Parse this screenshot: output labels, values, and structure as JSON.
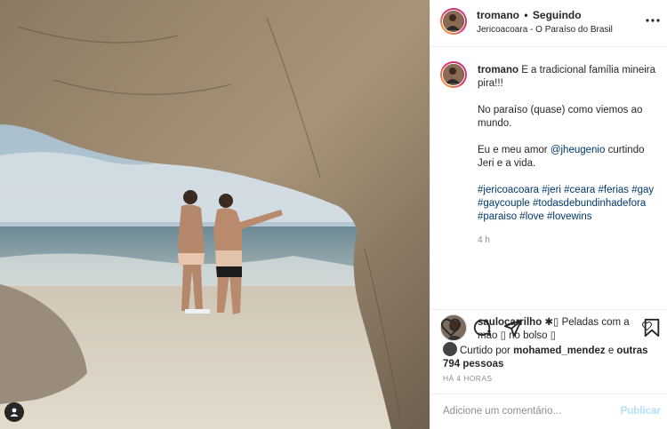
{
  "post": {
    "author": "tromano",
    "separator": "•",
    "follow_status": "Seguindo",
    "location": "Jericoacoara -  O Paraíso do Brasil",
    "more_icon": "more-horizontal-icon",
    "tag_icon": "user-tag-icon"
  },
  "caption": {
    "username": "tromano",
    "line1": " E a tradicional família mineira pira!!!",
    "line2": "No paraíso (quase) como viemos ao mundo.",
    "line3_before": "Eu e meu amor ",
    "mention": "@jheugenio",
    "line3_after": " curtindo Jeri e a vida.",
    "hashtags": "#jericoacoara #jeri #ceara #ferias #gay #gaycouple #todasdebundinhadefora #paraiso #love #lovewins",
    "time": "4 h"
  },
  "comment": {
    "username": "saulocarrilho",
    "text": " ✱▯ Peladas com a mão ▯ no bolso ▯",
    "like_icon": "heart-outline-icon"
  },
  "actions": {
    "like_icon": "heart-icon",
    "comment_icon": "comment-icon",
    "share_icon": "share-icon",
    "save_icon": "bookmark-icon"
  },
  "likes": {
    "prefix": "Curtido por ",
    "user": "mohamed_mendez",
    "middle": " e ",
    "others": "outras 794 pessoas"
  },
  "timestamp": "HÁ 4 HORAS",
  "composer": {
    "placeholder": "Adicione um comentário...",
    "publish_label": "Publicar"
  },
  "colors": {
    "link": "#00376b",
    "publish_disabled": "#b2dffc",
    "muted": "#8e8e8e"
  }
}
